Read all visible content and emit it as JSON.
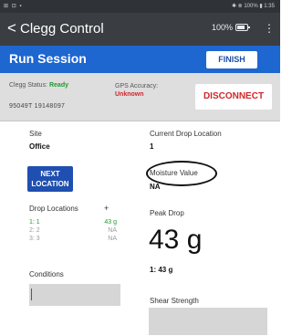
{
  "status_bar": {
    "left": "⊞ ⊡ ▪",
    "right": "✱ ⊗ 100% ▮ 1:35"
  },
  "app_bar": {
    "back_glyph": "<",
    "title": "Clegg Control",
    "battery": "100%",
    "menu_glyph": "⋮"
  },
  "session": {
    "title": "Run Session",
    "finish_label": "FINISH"
  },
  "connection": {
    "clegg_label": "Clegg Status:",
    "clegg_value": "Ready",
    "serial": "95049T 19148097",
    "gps_label": "GPS Accuracy:",
    "gps_value": "Unknown",
    "disconnect_label": "DISCONNECT"
  },
  "site": {
    "label": "Site",
    "value": "Office"
  },
  "next_location": {
    "line1": "NEXT",
    "line2": "LOCATION"
  },
  "drop_locations": {
    "label": "Drop Locations",
    "add_glyph": "+",
    "rows": [
      {
        "key": "1: 1",
        "value": "43 g",
        "state": "active"
      },
      {
        "key": "2: 2",
        "value": "NA",
        "state": "inactive"
      },
      {
        "key": "3: 3",
        "value": "NA",
        "state": "inactive"
      }
    ]
  },
  "conditions": {
    "label": "Conditions"
  },
  "current_drop": {
    "label": "Current Drop Location",
    "value": "1"
  },
  "moisture": {
    "label": "Moisture Value",
    "value": "NA"
  },
  "peak_drop": {
    "label": "Peak Drop",
    "value": "43 g",
    "detail": "1: 43 g"
  },
  "shear": {
    "label": "Shear Strength"
  },
  "colors": {
    "session_blue": "#1e66d0",
    "ready_green": "#1f9a2e",
    "alert_red": "#d0262b"
  }
}
